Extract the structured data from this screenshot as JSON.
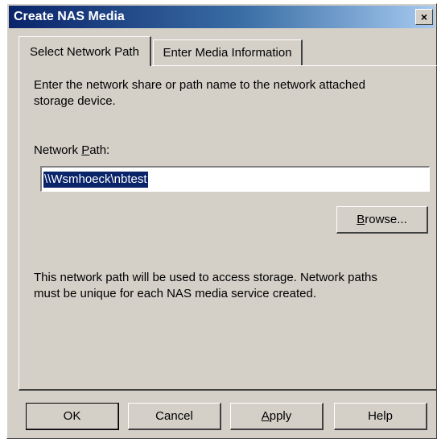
{
  "window": {
    "title": "Create NAS Media",
    "close_glyph": "×"
  },
  "tabs": [
    {
      "label": "Select Network Path",
      "active": true
    },
    {
      "label": "Enter Media Information",
      "active": false
    }
  ],
  "panel": {
    "instruction_line1": "Enter the network share or path name to the network attached",
    "instruction_line2": "storage device.",
    "network_path_label_pre": "Network ",
    "network_path_label_accel": "P",
    "network_path_label_post": "ath:",
    "network_path_value": "\\\\Wsmhoeck\\nbtest",
    "browse_button_accel": "B",
    "browse_button_rest": "rowse...",
    "note_line1": "This network path will be used to access storage.  Network paths",
    "note_line2": "must be unique for each NAS media service created."
  },
  "buttons": {
    "ok": "OK",
    "cancel": "Cancel",
    "apply_accel": "A",
    "apply_rest": "pply",
    "help": "Help"
  }
}
